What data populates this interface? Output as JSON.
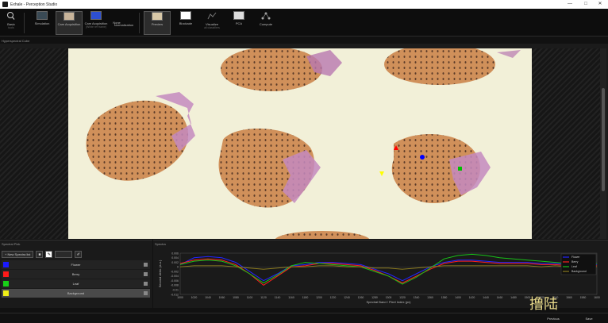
{
  "window": {
    "title": "Exhale - Perception Studio",
    "min_label": "—",
    "max_label": "□",
    "close_label": "✕"
  },
  "ribbon": {
    "buttons": [
      {
        "label": "Basic",
        "sub": "tools",
        "icon": "magnifier-icon",
        "active": false
      },
      {
        "label": "Simulation",
        "sub": "",
        "icon": "sim-icon",
        "active": false
      },
      {
        "label": "Cam Acquisition",
        "sub": "",
        "icon": "camera-icon",
        "active": true
      },
      {
        "label": "Cam Acquisition",
        "sub": "(White ref frame)",
        "icon": "whiteref-icon",
        "active": false
      },
      {
        "label": "None",
        "sub": "",
        "icon": "none-icon",
        "active": false
      },
      {
        "label": "Normalization",
        "sub": "",
        "icon": "norm-icon",
        "active": false
      },
      {
        "label": "Preview",
        "sub": "",
        "icon": "preview-icon",
        "active": true
      },
      {
        "label": "Blockade",
        "sub": "",
        "icon": "blockade-icon",
        "active": false
      },
      {
        "label": "Visualize",
        "sub": "all classifiers",
        "icon": "visualize-icon",
        "active": false
      },
      {
        "label": "PCA",
        "sub": "",
        "icon": "pca-icon",
        "active": false
      },
      {
        "label": "Compute",
        "sub": "",
        "icon": "compute-icon",
        "active": false
      }
    ]
  },
  "viewer": {
    "label": "Hyperspectral Cube"
  },
  "left_panel": {
    "title": "Spectral Pick",
    "new_spectra_label": "+ New Spectra list",
    "spectra": [
      {
        "name": "Flower",
        "color": "#1a1aff",
        "selected": false
      },
      {
        "name": "Berry",
        "color": "#ff1a1a",
        "selected": false
      },
      {
        "name": "Leaf",
        "color": "#18d018",
        "selected": false
      },
      {
        "name": "Background",
        "color": "#f0f018",
        "selected": true
      }
    ]
  },
  "right_panel": {
    "title": "Spectra",
    "ylabel": "Second deriv. (a.u.)",
    "xlabel": "Spectral Band / Pixel Index (px)"
  },
  "status": {
    "prev_label": "Previous",
    "save_label": "Save"
  },
  "watermark": {
    "text": "撸陆"
  },
  "chart_data": {
    "type": "line",
    "xlabel": "Spectral Band / Pixel Index (px)",
    "ylabel": "Second deriv. (a.u.)",
    "ylim": [
      -0.012,
      0.006
    ],
    "yticks": [
      0.006,
      0.004,
      0.002,
      0,
      -0.002,
      -0.004,
      -0.006,
      -0.008,
      -0.01,
      -0.012
    ],
    "xticks": [
      "1000",
      "1020",
      "1040",
      "1060",
      "1080",
      "1100",
      "1120",
      "1140",
      "1160",
      "1180",
      "1200",
      "1220",
      "1240",
      "1260",
      "1280",
      "1300",
      "1320",
      "1340",
      "1360",
      "1380",
      "1400",
      "1420",
      "1440",
      "1460",
      "1480",
      "1500",
      "1520",
      "1540",
      "1560",
      "1580",
      "1600"
    ],
    "x": [
      0,
      1,
      2,
      3,
      4,
      5,
      6,
      7,
      8,
      9,
      10,
      11,
      12,
      13,
      14,
      15,
      16,
      17,
      18,
      19,
      20,
      21,
      22,
      23,
      24,
      25,
      26,
      27,
      28,
      29,
      30
    ],
    "series": [
      {
        "name": "Flower",
        "color": "#2424ff",
        "values": [
          0.001,
          0.004,
          0.0045,
          0.004,
          0.002,
          -0.002,
          -0.006,
          -0.003,
          0.0005,
          0.001,
          0.002,
          0.002,
          0.0015,
          0.001,
          -0.001,
          -0.003,
          -0.006,
          -0.003,
          0.0,
          0.002,
          0.003,
          0.003,
          0.0025,
          0.002,
          0.002,
          0.002,
          0.0015,
          0.0015,
          0.001,
          0.0015,
          0.001
        ]
      },
      {
        "name": "Berry",
        "color": "#ff2020",
        "values": [
          0.0015,
          0.003,
          0.0035,
          0.003,
          0.001,
          -0.003,
          -0.008,
          -0.004,
          0.0,
          0.0005,
          0.0015,
          0.0015,
          0.001,
          0.0005,
          -0.0015,
          -0.004,
          -0.007,
          -0.004,
          -0.001,
          0.0015,
          0.0025,
          0.0025,
          0.002,
          0.0015,
          0.0015,
          0.0015,
          0.001,
          0.001,
          0.0005,
          0.001,
          0.0005
        ]
      },
      {
        "name": "Leaf",
        "color": "#18c018",
        "values": [
          0.001,
          0.0025,
          0.003,
          0.0025,
          0.0005,
          -0.003,
          -0.007,
          -0.0035,
          0.0005,
          0.002,
          0.0015,
          0.001,
          0.0005,
          0.0,
          -0.002,
          -0.004,
          -0.0075,
          -0.0045,
          -0.0005,
          0.0035,
          0.005,
          0.0055,
          0.005,
          0.004,
          0.0035,
          0.003,
          0.0025,
          0.002,
          0.0015,
          0.002,
          0.0015
        ]
      },
      {
        "name": "Background",
        "color": "#8a7a20",
        "values": [
          0.0,
          0.0005,
          0.0005,
          0.0005,
          0.0,
          -0.0005,
          -0.001,
          -0.0005,
          0.0,
          0.0,
          0.0005,
          0.0005,
          0.0,
          0.0,
          -0.0005,
          -0.0005,
          -0.001,
          -0.0005,
          0.0,
          0.0005,
          0.0005,
          0.0005,
          0.0005,
          0.0005,
          0.0005,
          0.0005,
          0.0,
          0.0005,
          0.0,
          0.0005,
          0.0
        ]
      }
    ],
    "legend_position": "top-right",
    "grid": false,
    "markers": [
      {
        "series": "Berry",
        "color": "#ff0000"
      },
      {
        "series": "Flower",
        "color": "#0000ff"
      },
      {
        "series": "Leaf",
        "color": "#00c000"
      },
      {
        "series": "Background",
        "color": "#ffff00"
      }
    ]
  }
}
